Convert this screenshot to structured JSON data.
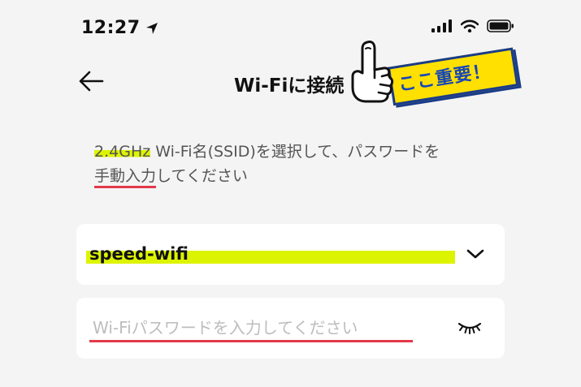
{
  "status_bar": {
    "time": "12:27",
    "icons": [
      "location-arrow-icon",
      "signal-icon",
      "wifi-icon",
      "battery-icon"
    ]
  },
  "nav": {
    "back_icon": "arrow-left-icon",
    "title": "Wi-Fiに接続"
  },
  "callout": {
    "text": "ここ重要！",
    "icon": "pointing-hand-icon",
    "colors": {
      "fill": "#ffe000",
      "border": "#1a3c8a",
      "text": "#1646b8"
    }
  },
  "instruction": {
    "band": "2.4GHz",
    "line1_rest": " Wi-Fi名(SSID)を選択して、パスワードを",
    "manual": "手動入力",
    "line2_rest": "してください"
  },
  "ssid_select": {
    "value": "speed-wifi",
    "icon": "chevron-down-icon"
  },
  "password": {
    "placeholder": "Wi-Fiパスワードを入力してください",
    "value": "",
    "toggle_icon": "eye-closed-icon"
  },
  "colors": {
    "highlight": "#ddf400",
    "underline": "#e23a4a",
    "background": "#f4f4f4"
  }
}
